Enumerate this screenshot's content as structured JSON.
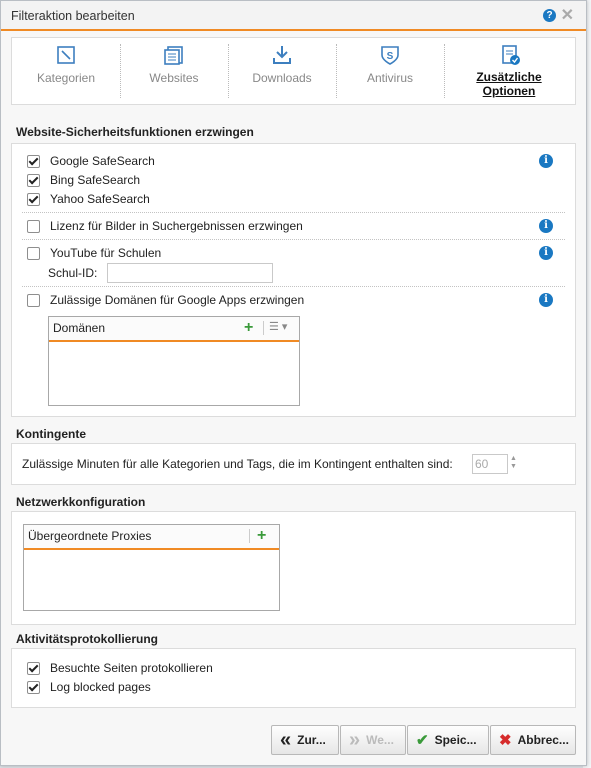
{
  "dialog": {
    "title": "Filteraktion bearbeiten",
    "help_icon": "?",
    "close_icon": "✕"
  },
  "tabs": [
    {
      "label": "Kategorien",
      "icon": "category-icon",
      "active": false
    },
    {
      "label": "Websites",
      "icon": "websites-icon",
      "active": false
    },
    {
      "label": "Downloads",
      "icon": "download-icon",
      "active": false
    },
    {
      "label": "Antivirus",
      "icon": "antivirus-shield-icon",
      "active": false
    },
    {
      "label": "Zusätzliche Optionen",
      "icon": "additional-options-icon",
      "active": true
    }
  ],
  "security": {
    "heading": "Website-Sicherheitsfunktionen erzwingen",
    "google_safesearch": {
      "label": "Google SafeSearch",
      "checked": true
    },
    "bing_safesearch": {
      "label": "Bing SafeSearch",
      "checked": true
    },
    "yahoo_safesearch": {
      "label": "Yahoo SafeSearch",
      "checked": true
    },
    "image_license": {
      "label": "Lizenz für Bilder in Suchergebnissen erzwingen",
      "checked": false
    },
    "youtube_schools": {
      "label": "YouTube für Schulen",
      "checked": false
    },
    "school_id": {
      "label": "Schul-ID:",
      "value": ""
    },
    "google_apps": {
      "label": "Zulässige Domänen für Google Apps erzwingen",
      "checked": false
    },
    "domains_list": {
      "header": "Domänen",
      "items": []
    }
  },
  "quota": {
    "heading": "Kontingente",
    "label": "Zulässige Minuten für alle Kategorien und Tags, die im Kontingent enthalten sind:",
    "value": "60"
  },
  "network": {
    "heading": "Netzwerkkonfiguration",
    "proxies_list": {
      "header": "Übergeordnete Proxies",
      "items": []
    }
  },
  "logging": {
    "heading": "Aktivitätsprotokollierung",
    "visited_pages": {
      "label": "Besuchte Seiten protokollieren",
      "checked": true
    },
    "blocked_pages": {
      "label": "Log blocked pages",
      "checked": true
    }
  },
  "buttons": {
    "back": "Zur...",
    "next": "We...",
    "save": "Speic...",
    "cancel": "Abbrec..."
  },
  "colors": {
    "accent": "#f08a24",
    "info": "#1a78c2",
    "add": "#3a9a3a",
    "cancel": "#d62b2b"
  }
}
